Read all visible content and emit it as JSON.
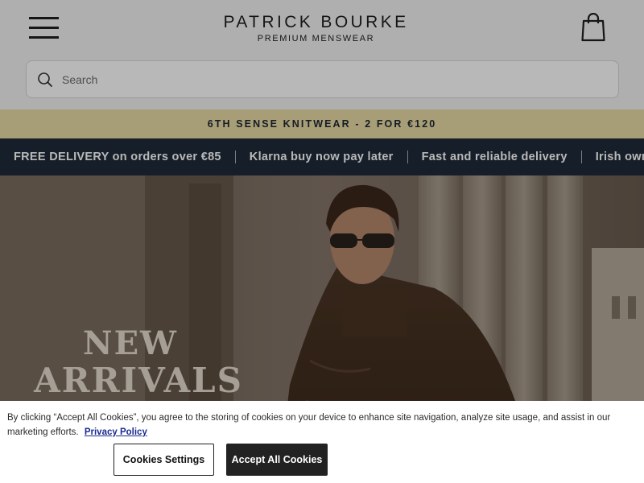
{
  "brand": {
    "name": "PATRICK BOURKE",
    "tagline": "PREMIUM MENSWEAR"
  },
  "header": {
    "menu_icon": "hamburger-menu-icon",
    "bag_icon": "shopping-bag-icon"
  },
  "search": {
    "placeholder": "Search",
    "value": "",
    "icon": "search-icon"
  },
  "promo": {
    "text": "6TH SENSE KNITWEAR - 2 FOR €120",
    "background": "#e8dca5"
  },
  "usp": {
    "items": [
      "FREE DELIVERY on orders over €85",
      "Klarna buy now pay later",
      "Fast and reliable delivery",
      "Irish owned"
    ],
    "background": "#1f2c3a"
  },
  "hero": {
    "line1": "NEW",
    "line2": "ARRIVALS"
  },
  "cookie": {
    "text": "By clicking “Accept All Cookies”, you agree to the storing of cookies on your device to enhance site navigation, analyze site usage, and assist in our marketing efforts.",
    "link_label": "Privacy Policy",
    "settings_label": "Cookies Settings",
    "accept_label": "Accept All Cookies"
  }
}
